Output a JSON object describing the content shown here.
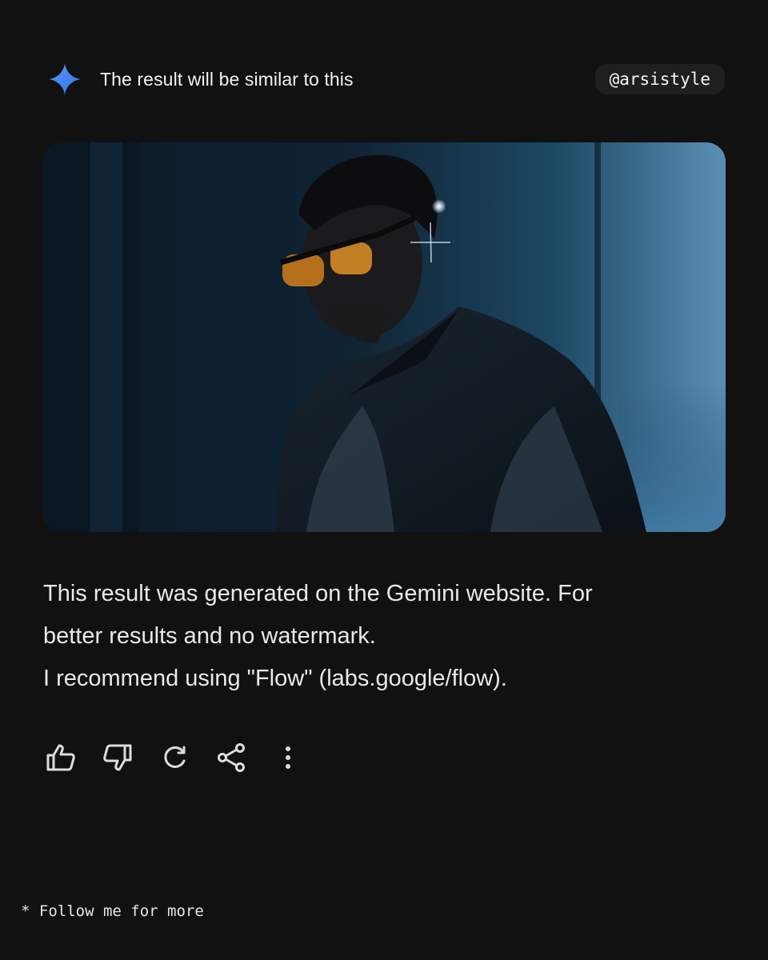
{
  "header": {
    "icon": "gemini-sparkle-icon",
    "title": "The result will be similar to this",
    "handle": "@arsistyle"
  },
  "image": {
    "subject": "man-in-sunglasses-and-embroidered-jacket-photo"
  },
  "message": {
    "line1": "This result was generated on the Gemini website. For",
    "line2": "better results and no watermark.",
    "line3": "I recommend using \"Flow\" (labs.google/flow)."
  },
  "actions": [
    {
      "icon": "thumbs-up-icon"
    },
    {
      "icon": "thumbs-down-icon"
    },
    {
      "icon": "refresh-icon"
    },
    {
      "icon": "share-icon"
    },
    {
      "icon": "more-vertical-icon"
    }
  ],
  "footer": {
    "text": "* Follow me for more"
  },
  "colors": {
    "background": "#111111",
    "gemini_blue": "#4b8bf5",
    "handle_pill": "#1f1f1f",
    "text": "#e9e9e9"
  }
}
